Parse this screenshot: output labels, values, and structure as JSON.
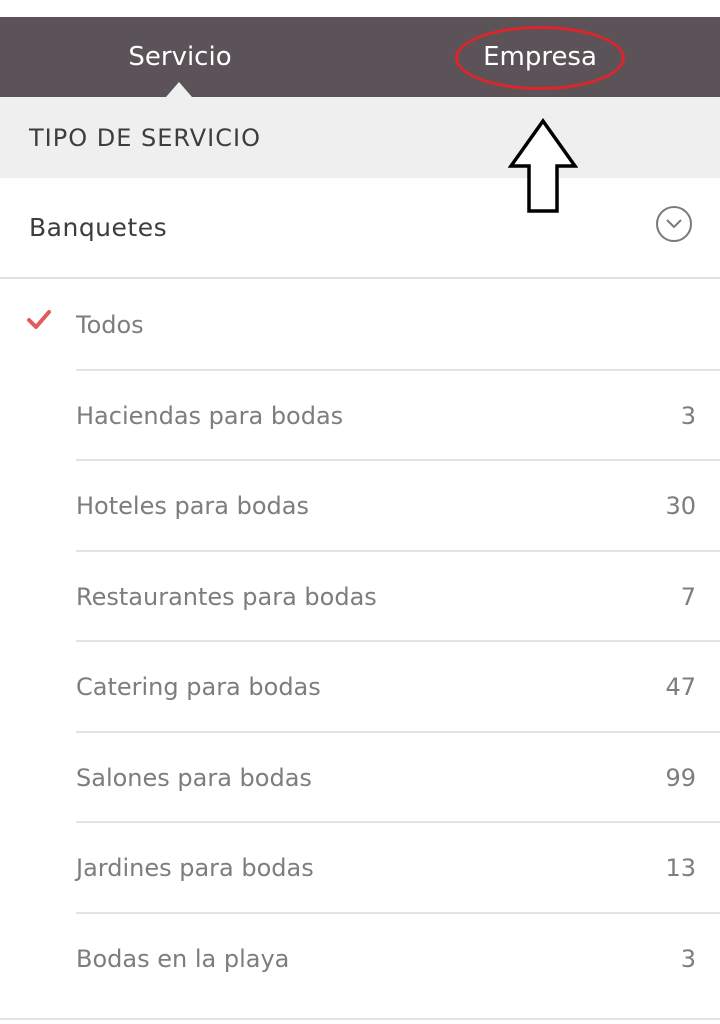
{
  "tabs": [
    {
      "label": "Servicio",
      "active": true
    },
    {
      "label": "Empresa",
      "active": false
    }
  ],
  "section": {
    "title": "TIPO DE SERVICIO"
  },
  "category": {
    "label": "Banquetes",
    "icon": "chevron-down-circle-icon"
  },
  "items": [
    {
      "label": "Todos",
      "count": "",
      "selected": true
    },
    {
      "label": "Haciendas para bodas",
      "count": "3"
    },
    {
      "label": "Hoteles para bodas",
      "count": "30"
    },
    {
      "label": "Restaurantes para bodas",
      "count": "7"
    },
    {
      "label": "Catering para bodas",
      "count": "47"
    },
    {
      "label": "Salones para bodas",
      "count": "99"
    },
    {
      "label": "Jardines para bodas",
      "count": "13"
    },
    {
      "label": "Bodas en la playa",
      "count": "3"
    }
  ],
  "colors": {
    "tab_bar": "#5b5358",
    "section_bg": "#efefef",
    "check": "#e05a5e",
    "annotation_red": "#e0242b"
  }
}
